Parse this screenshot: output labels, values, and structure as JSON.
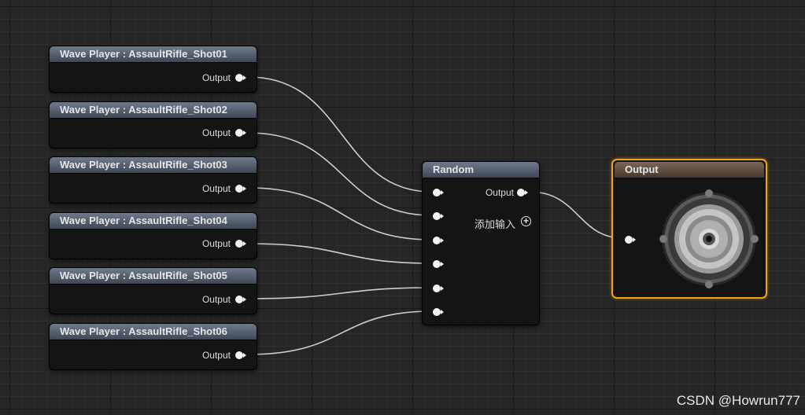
{
  "wave_players": [
    {
      "title": "Wave Player : AssaultRifle_Shot01",
      "output_label": "Output"
    },
    {
      "title": "Wave Player : AssaultRifle_Shot02",
      "output_label": "Output"
    },
    {
      "title": "Wave Player : AssaultRifle_Shot03",
      "output_label": "Output"
    },
    {
      "title": "Wave Player : AssaultRifle_Shot04",
      "output_label": "Output"
    },
    {
      "title": "Wave Player : AssaultRifle_Shot05",
      "output_label": "Output"
    },
    {
      "title": "Wave Player : AssaultRifle_Shot06",
      "output_label": "Output"
    }
  ],
  "random_node": {
    "title": "Random",
    "output_label": "Output",
    "add_input_label": "添加输入"
  },
  "output_node": {
    "title": "Output"
  },
  "watermark": "CSDN @Howrun777",
  "colors": {
    "selected_border": "#f0a21a",
    "wire": "#d0d0d0",
    "pin": "#f2f2f2"
  }
}
